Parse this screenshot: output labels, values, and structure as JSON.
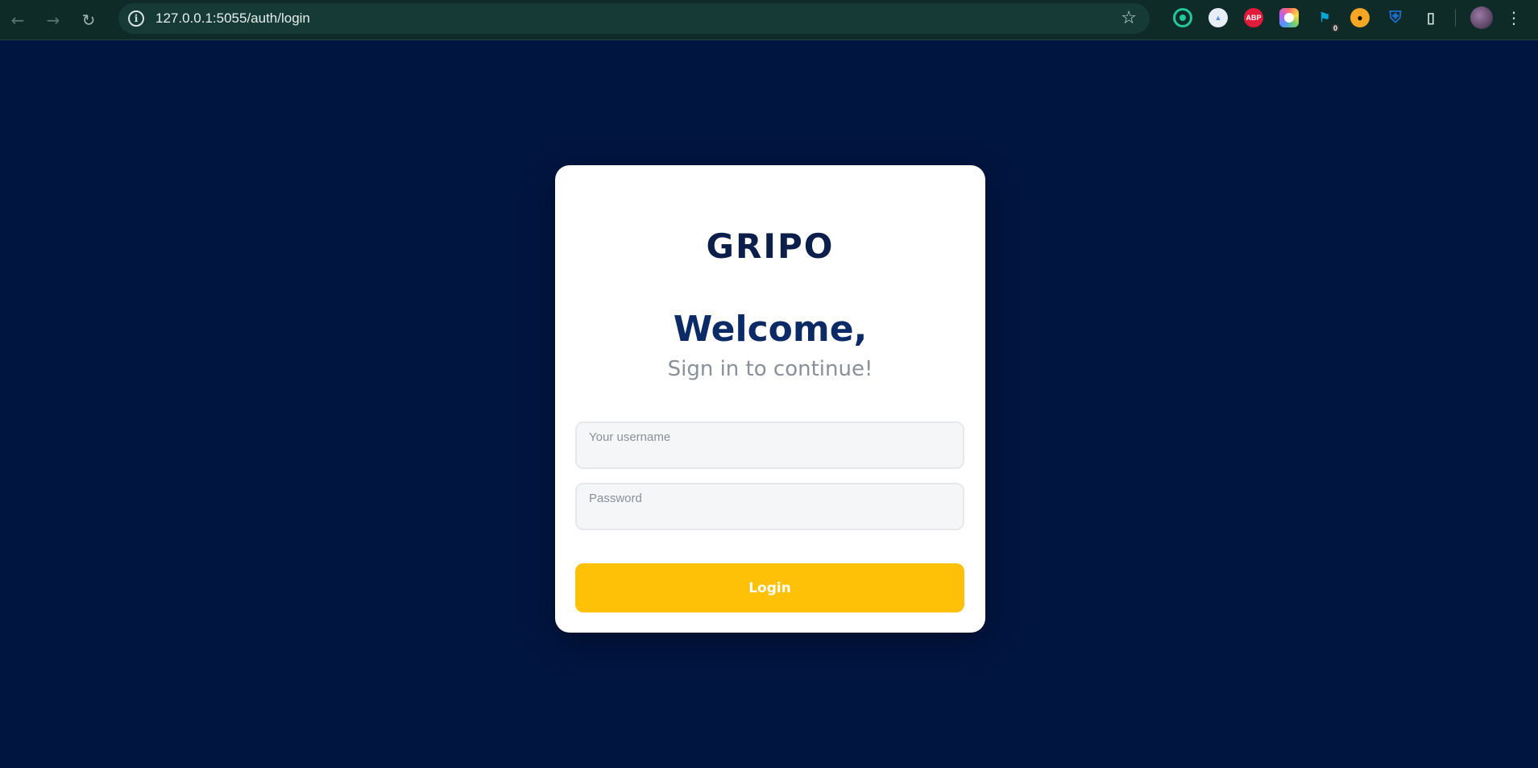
{
  "browser": {
    "url": "127.0.0.1:5055/auth/login",
    "nav": {
      "back_icon": "back-arrow-icon",
      "forward_icon": "forward-arrow-icon",
      "reload_icon": "reload-icon"
    },
    "site_info_icon": "i",
    "bookmark_icon": "star-icon",
    "extensions": [
      {
        "name": "target-extension",
        "label": "",
        "color": "#20c997"
      },
      {
        "name": "bird-extension",
        "label": "",
        "color": "#5b8def"
      },
      {
        "name": "adblock-extension",
        "label": "ABP",
        "color": "#e31b3b"
      },
      {
        "name": "color-extension",
        "label": "",
        "color": "#c05bf0"
      },
      {
        "name": "counter-extension",
        "label": "",
        "badge": "0",
        "color": "#00a6d6"
      },
      {
        "name": "duck-extension",
        "label": "",
        "color": "#f5a623"
      },
      {
        "name": "shield-extension",
        "label": "",
        "color": "#1d6fd1"
      },
      {
        "name": "puzzle-extension",
        "label": "",
        "color": "#cfdcd9"
      }
    ]
  },
  "card": {
    "brand": "GRIPO",
    "welcome": "Welcome,",
    "subtitle": "Sign in to continue!",
    "username_label": "Your username",
    "password_label": "Password",
    "login_label": "Login"
  },
  "colors": {
    "page_background": "#001540",
    "card_background": "#ffffff",
    "welcome_text": "#0b2a66",
    "button": "#ffc107"
  }
}
